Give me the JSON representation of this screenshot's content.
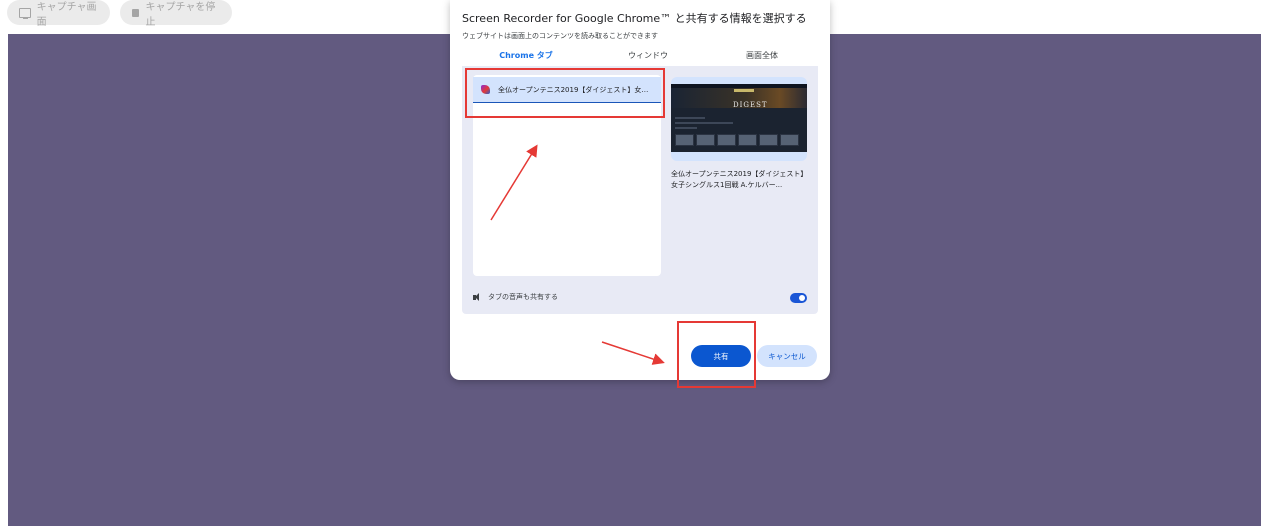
{
  "toolbar": {
    "capture_screen_label": "キャプチャ画面",
    "stop_capture_label": "キャプチャを停止"
  },
  "dialog": {
    "title": "Screen Recorder for Google Chrome™ と共有する情報を選択する",
    "subtitle": "ウェブサイトは画面上のコンテンツを読み取ることができます",
    "tabs": [
      {
        "label": "Chrome タブ",
        "active": true
      },
      {
        "label": "ウィンドウ",
        "active": false
      },
      {
        "label": "画面全体",
        "active": false
      }
    ],
    "tab_list": [
      {
        "label": "全仏オープンテニス2019【ダイジェスト】女子シングルス1回戦 A.ケルバー",
        "selected": true
      }
    ],
    "preview": {
      "thumbnail_text": "DIGEST",
      "caption": "全仏オープンテニス2019【ダイジェスト】女子シングルス1回戦 A.ケルバー..."
    },
    "audio_label": "タブの音声も共有する",
    "audio_enabled": true,
    "share_button": "共有",
    "cancel_button": "キャンセル"
  },
  "colors": {
    "accent": "#0b57d0",
    "annotation": "#e53935",
    "backdrop": "#625a80"
  }
}
